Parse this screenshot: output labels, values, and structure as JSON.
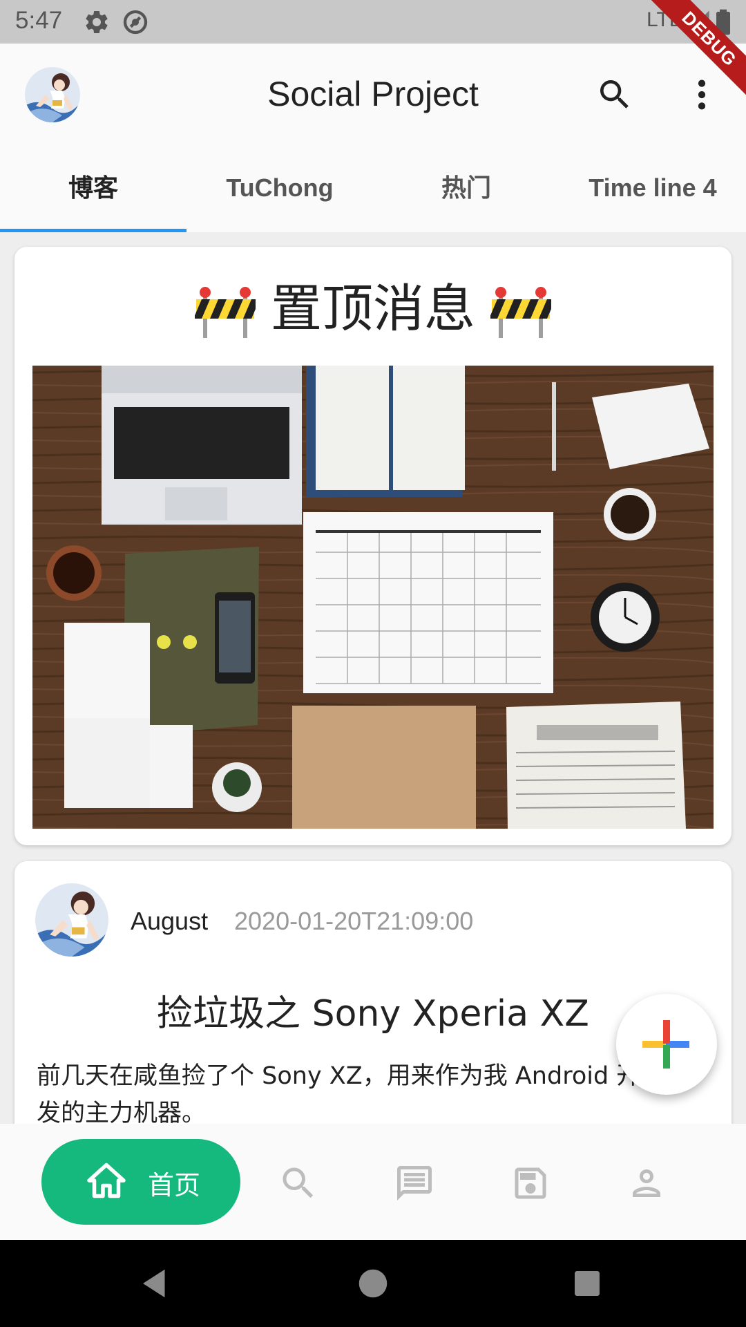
{
  "status_bar": {
    "time": "5:47",
    "network": "LTE",
    "debug_label": "DEBUG"
  },
  "app_bar": {
    "title": "Social Project"
  },
  "tabs": [
    {
      "label": "博客",
      "active": true
    },
    {
      "label": "TuChong",
      "active": false
    },
    {
      "label": "热门",
      "active": false
    },
    {
      "label": "Time line 4",
      "active": false
    }
  ],
  "pinned_card": {
    "title": "置顶消息"
  },
  "post": {
    "author": "August",
    "time": "2020-01-20T21:09:00",
    "title": "捡垃圾之 Sony Xperia XZ",
    "body": "前几天在咸鱼捡了个 Sony XZ，用来作为我 Android 开发的主力机器。"
  },
  "bottom_nav": {
    "home_label": "首页",
    "items": [
      "home",
      "search",
      "message",
      "save",
      "person"
    ]
  },
  "colors": {
    "accent": "#15b97e",
    "tab_indicator": "#2196f3",
    "debug": "#b71c1c"
  }
}
